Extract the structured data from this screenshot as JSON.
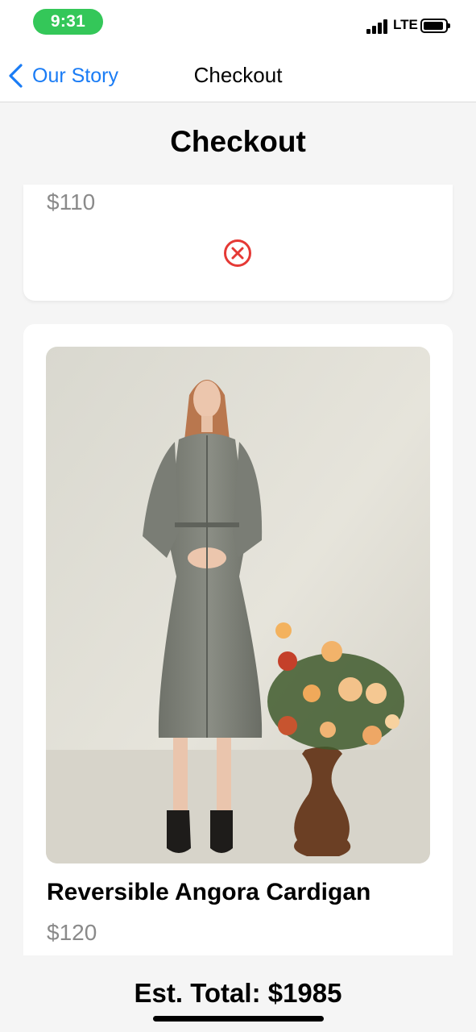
{
  "status_bar": {
    "time": "9:31",
    "network": "LTE",
    "time_pill_color": "#34c759"
  },
  "nav": {
    "back_label": "Our Story",
    "title": "Checkout",
    "accent_color": "#1a7cf5"
  },
  "page": {
    "title": "Checkout"
  },
  "cart_items": [
    {
      "price": "$110",
      "remove_icon": "close-circle-icon",
      "remove_color": "#e53935"
    },
    {
      "name": "Reversible Angora Cardigan",
      "price": "$120",
      "image": "model in grey tailored coat dress beside flower arrangement"
    }
  ],
  "footer": {
    "total_label": "Est. Total: $1985"
  }
}
